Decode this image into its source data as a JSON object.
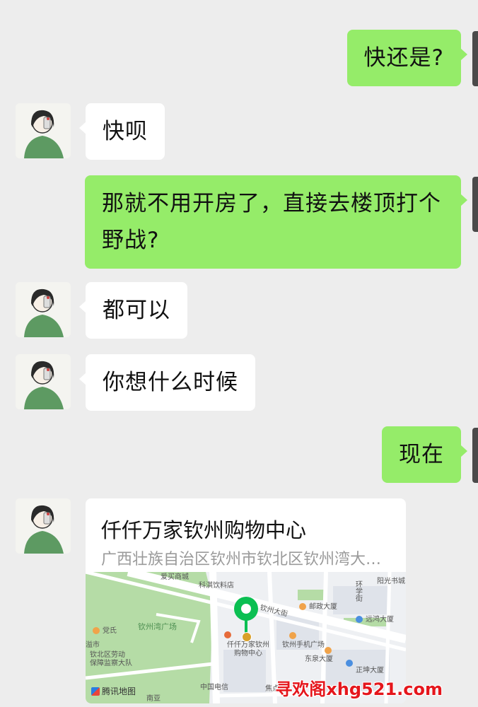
{
  "messages": [
    {
      "side": "out",
      "text": "快还是?"
    },
    {
      "side": "in",
      "text": "快呗"
    },
    {
      "side": "out",
      "text": "那就不用开房了，直接去楼顶打个野战?"
    },
    {
      "side": "in",
      "text": "都可以"
    },
    {
      "side": "in",
      "text": "你想什么时候"
    },
    {
      "side": "out",
      "text": "现在"
    }
  ],
  "location_card": {
    "title": "仟仟万家钦州购物中心",
    "address": "广西壮族自治区钦州市钦北区钦州湾大…",
    "map": {
      "provider": "腾讯地图",
      "labels": {
        "shop_top": "爱买商城",
        "liqi_hotel": "科淇饮料店",
        "road_west": "钦州大街",
        "park": "钦州湾广场",
        "party": "党氏",
        "mall_name": "仟仟万家钦州\n购物中心",
        "phone_plaza": "钦州手机广场",
        "post": "邮政大厦",
        "dongquan": "东泉大厦",
        "zhengkun": "正坤大厦",
        "yuanxing": "远鸿大厦",
        "sunlight": "阳光书城",
        "huanxue": "环\n学\n街",
        "labor_bureau": "钦北区劳动\n保障监察大队",
        "side_city": "溢市",
        "telecom": "中国电信",
        "jiaodian": "焦点导",
        "nanyi": "南亚"
      }
    }
  },
  "watermark": "寻欢阁xhg521.com",
  "colors": {
    "background": "#ededed",
    "incoming_bubble": "#ffffff",
    "outgoing_bubble": "#95ec69",
    "pin": "#0bbf52",
    "watermark": "#e5161c"
  }
}
